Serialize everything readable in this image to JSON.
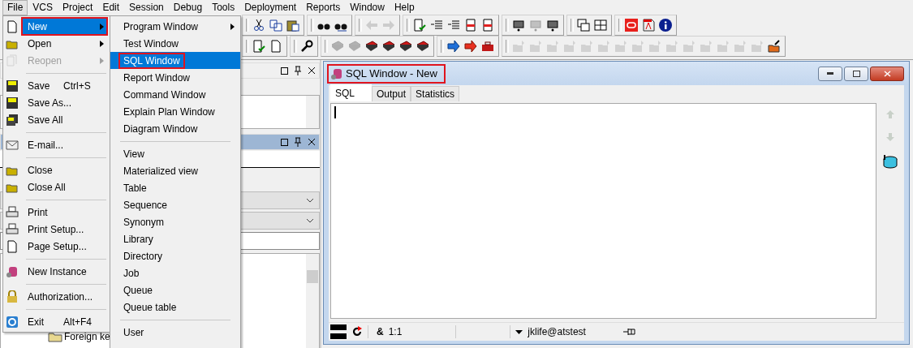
{
  "menu_bar": [
    {
      "label": "File",
      "selected": true
    },
    {
      "label": "VCS",
      "selected": false
    },
    {
      "label": "Project",
      "selected": false
    },
    {
      "label": "Edit",
      "selected": false
    },
    {
      "label": "Session",
      "selected": false
    },
    {
      "label": "Debug",
      "selected": false
    },
    {
      "label": "Tools",
      "selected": false
    },
    {
      "label": "Deployment",
      "selected": false
    },
    {
      "label": "Reports",
      "selected": false
    },
    {
      "label": "Window",
      "selected": false
    },
    {
      "label": "Help",
      "selected": false
    }
  ],
  "toolbars": [
    {
      "groups": [
        [
          {
            "disabled": false
          },
          {
            "disabled": false
          },
          {
            "disabled": false
          }
        ],
        [
          {
            "disabled": false
          },
          {
            "disabled": false
          }
        ],
        [
          {
            "disabled": true
          },
          {
            "disabled": true
          }
        ],
        [
          {
            "disabled": false
          },
          {
            "disabled": false
          },
          {
            "disabled": false
          },
          {
            "disabled": false
          },
          {
            "disabled": false
          }
        ],
        [
          {
            "disabled": false
          },
          {
            "disabled": true
          },
          {
            "disabled": false
          }
        ],
        [
          {
            "disabled": false
          },
          {
            "disabled": false
          }
        ],
        [
          {
            "disabled": false
          },
          {
            "disabled": false
          },
          {
            "disabled": false
          }
        ]
      ]
    },
    {
      "groups": [
        [
          {
            "disabled": false
          },
          {
            "disabled": false
          }
        ],
        [
          {
            "disabled": false
          }
        ],
        [
          {
            "disabled": true
          },
          {
            "disabled": true
          },
          {
            "disabled": false
          },
          {
            "disabled": false
          },
          {
            "disabled": false
          },
          {
            "disabled": false
          }
        ],
        [
          {
            "disabled": false
          },
          {
            "disabled": false
          },
          {
            "disabled": false
          }
        ],
        [
          {
            "disabled": true
          },
          {
            "disabled": true
          },
          {
            "disabled": true
          },
          {
            "disabled": true
          },
          {
            "disabled": true
          },
          {
            "disabled": true
          },
          {
            "disabled": true
          },
          {
            "disabled": true
          },
          {
            "disabled": true
          },
          {
            "disabled": true
          },
          {
            "disabled": true
          },
          {
            "disabled": true
          },
          {
            "disabled": true
          },
          {
            "disabled": true
          },
          {
            "disabled": true
          },
          {
            "disabled": false
          }
        ]
      ]
    }
  ],
  "left_panel": {
    "tree": [
      {
        "label": "Foreign ke"
      }
    ]
  },
  "file_menu": [
    {
      "kind": "item",
      "label": "New",
      "submenu": true,
      "disabled": false,
      "selected": true,
      "highlighted": true
    },
    {
      "kind": "item",
      "label": "Open",
      "submenu": true,
      "disabled": false,
      "selected": false,
      "highlighted": false
    },
    {
      "kind": "item",
      "label": "Reopen",
      "submenu": true,
      "disabled": true,
      "selected": false,
      "highlighted": false
    },
    {
      "kind": "separator"
    },
    {
      "kind": "item",
      "label": "Save",
      "shortcut": "Ctrl+S",
      "submenu": false,
      "disabled": false,
      "selected": false,
      "highlighted": false
    },
    {
      "kind": "item",
      "label": "Save As...",
      "submenu": false,
      "disabled": false,
      "selected": false,
      "highlighted": false
    },
    {
      "kind": "item",
      "label": "Save All",
      "submenu": false,
      "disabled": false,
      "selected": false,
      "highlighted": false
    },
    {
      "kind": "separator"
    },
    {
      "kind": "item",
      "label": "E-mail...",
      "submenu": false,
      "disabled": false,
      "selected": false,
      "highlighted": false
    },
    {
      "kind": "separator"
    },
    {
      "kind": "item",
      "label": "Close",
      "submenu": false,
      "disabled": false,
      "selected": false,
      "highlighted": false
    },
    {
      "kind": "item",
      "label": "Close All",
      "submenu": false,
      "disabled": false,
      "selected": false,
      "highlighted": false
    },
    {
      "kind": "separator"
    },
    {
      "kind": "item",
      "label": "Print",
      "submenu": false,
      "disabled": false,
      "selected": false,
      "highlighted": false
    },
    {
      "kind": "item",
      "label": "Print Setup...",
      "submenu": false,
      "disabled": false,
      "selected": false,
      "highlighted": false
    },
    {
      "kind": "item",
      "label": "Page Setup...",
      "submenu": false,
      "disabled": false,
      "selected": false,
      "highlighted": false
    },
    {
      "kind": "separator"
    },
    {
      "kind": "item",
      "label": "New Instance",
      "submenu": false,
      "disabled": false,
      "selected": false,
      "highlighted": false
    },
    {
      "kind": "separator"
    },
    {
      "kind": "item",
      "label": "Authorization...",
      "submenu": false,
      "disabled": false,
      "selected": false,
      "highlighted": false
    },
    {
      "kind": "separator"
    },
    {
      "kind": "item",
      "label": "Exit",
      "shortcut": "Alt+F4",
      "submenu": false,
      "disabled": false,
      "selected": false,
      "highlighted": false
    }
  ],
  "new_submenu": [
    {
      "kind": "item",
      "label": "Program Window",
      "submenu": true,
      "selected": false,
      "highlighted": false
    },
    {
      "kind": "item",
      "label": "Test Window",
      "submenu": false,
      "selected": false,
      "highlighted": false
    },
    {
      "kind": "item",
      "label": "SQL Window",
      "submenu": false,
      "selected": true,
      "highlighted": true
    },
    {
      "kind": "item",
      "label": "Report Window",
      "submenu": false,
      "selected": false,
      "highlighted": false
    },
    {
      "kind": "item",
      "label": "Command Window",
      "submenu": false,
      "selected": false,
      "highlighted": false
    },
    {
      "kind": "item",
      "label": "Explain Plan Window",
      "submenu": false,
      "selected": false,
      "highlighted": false
    },
    {
      "kind": "item",
      "label": "Diagram Window",
      "submenu": false,
      "selected": false,
      "highlighted": false
    },
    {
      "kind": "separator"
    },
    {
      "kind": "item",
      "label": "View",
      "submenu": false,
      "selected": false,
      "highlighted": false
    },
    {
      "kind": "item",
      "label": "Materialized view",
      "submenu": false,
      "selected": false,
      "highlighted": false
    },
    {
      "kind": "item",
      "label": "Table",
      "submenu": false,
      "selected": false,
      "highlighted": false
    },
    {
      "kind": "item",
      "label": "Sequence",
      "submenu": false,
      "selected": false,
      "highlighted": false
    },
    {
      "kind": "item",
      "label": "Synonym",
      "submenu": false,
      "selected": false,
      "highlighted": false
    },
    {
      "kind": "item",
      "label": "Library",
      "submenu": false,
      "selected": false,
      "highlighted": false
    },
    {
      "kind": "item",
      "label": "Directory",
      "submenu": false,
      "selected": false,
      "highlighted": false
    },
    {
      "kind": "item",
      "label": "Job",
      "submenu": false,
      "selected": false,
      "highlighted": false
    },
    {
      "kind": "item",
      "label": "Queue",
      "submenu": false,
      "selected": false,
      "highlighted": false
    },
    {
      "kind": "item",
      "label": "Queue table",
      "submenu": false,
      "selected": false,
      "highlighted": false
    },
    {
      "kind": "separator"
    },
    {
      "kind": "item",
      "label": "User",
      "submenu": false,
      "selected": false,
      "highlighted": false
    }
  ],
  "sql_window": {
    "title": "SQL Window - New",
    "highlighted": true,
    "tabs": [
      {
        "label": "SQL",
        "selected": true
      },
      {
        "label": "Output",
        "selected": false
      },
      {
        "label": "Statistics",
        "selected": false
      }
    ],
    "status": {
      "symbol": "&",
      "position": "1:1",
      "connection": "jklife@atstest"
    }
  }
}
